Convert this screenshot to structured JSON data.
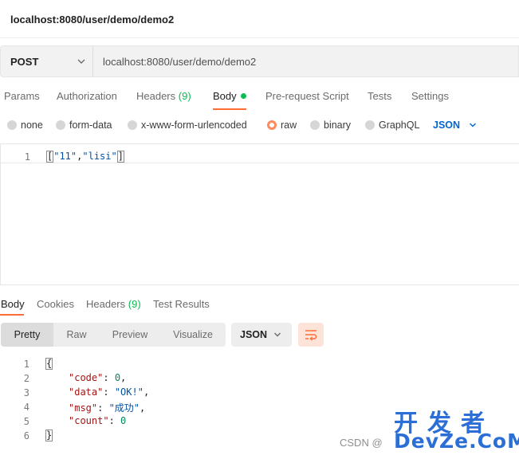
{
  "request": {
    "title": "localhost:8080/user/demo/demo2",
    "method": "POST",
    "url": "localhost:8080/user/demo/demo2"
  },
  "request_tabs": [
    {
      "label": "Params"
    },
    {
      "label": "Authorization"
    },
    {
      "label": "Headers",
      "count": "(9)"
    },
    {
      "label": "Body"
    },
    {
      "label": "Pre-request Script"
    },
    {
      "label": "Tests"
    },
    {
      "label": "Settings"
    }
  ],
  "body_types": [
    {
      "label": "none",
      "selected": false
    },
    {
      "label": "form-data",
      "selected": false
    },
    {
      "label": "x-www-form-urlencoded",
      "selected": false
    },
    {
      "label": "raw",
      "selected": true
    },
    {
      "label": "binary",
      "selected": false
    },
    {
      "label": "GraphQL",
      "selected": false
    }
  ],
  "raw_language": "JSON",
  "request_body": {
    "line_number": "1",
    "open": "[",
    "items": [
      "\"11\"",
      "\"lisi\""
    ],
    "sep": ",",
    "close": "]"
  },
  "response_tabs": [
    {
      "label": "Body"
    },
    {
      "label": "Cookies"
    },
    {
      "label": "Headers",
      "count": "(9)"
    },
    {
      "label": "Test Results"
    }
  ],
  "response_formats": [
    "Pretty",
    "Raw",
    "Preview",
    "Visualize"
  ],
  "response_language": "JSON",
  "response_body": {
    "line_numbers": [
      "1",
      "2",
      "3",
      "4",
      "5",
      "6"
    ],
    "open": "{",
    "close": "}",
    "fields": [
      {
        "key": "\"code\"",
        "value": "0",
        "type": "num",
        "comma": ","
      },
      {
        "key": "\"data\"",
        "value": "\"OK!\"",
        "type": "str",
        "comma": ","
      },
      {
        "key": "\"msg\"",
        "value": "\"成功\"",
        "type": "str",
        "comma": ","
      },
      {
        "key": "\"count\"",
        "value": "0",
        "type": "num",
        "comma": ""
      }
    ]
  },
  "watermark": {
    "csdn": "CSDN @",
    "cn": "开发者",
    "en": "DevZe.CoM"
  },
  "colors": {
    "accent": "#ff6c37",
    "count_green": "#0cbb52",
    "link_blue": "#0265d2"
  }
}
